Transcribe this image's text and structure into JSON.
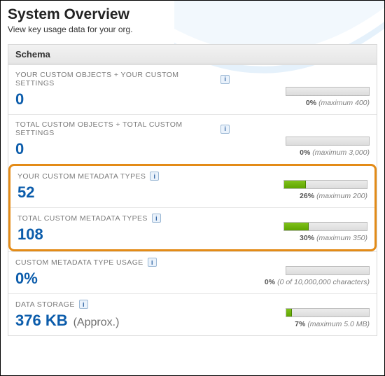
{
  "header": {
    "title": "System Overview",
    "subtitle": "View key usage data for your org."
  },
  "panel": {
    "title": "Schema"
  },
  "rows": [
    {
      "label": "YOUR CUSTOM OBJECTS + YOUR CUSTOM SETTINGS",
      "value": "0",
      "pct_label": "0%",
      "caption": "(maximum 400)",
      "fill_pct": 0
    },
    {
      "label": "TOTAL CUSTOM OBJECTS + TOTAL CUSTOM SETTINGS",
      "value": "0",
      "pct_label": "0%",
      "caption": "(maximum 3,000)",
      "fill_pct": 0
    },
    {
      "label": "YOUR CUSTOM METADATA TYPES",
      "value": "52",
      "pct_label": "26%",
      "caption": "(maximum 200)",
      "fill_pct": 26
    },
    {
      "label": "TOTAL CUSTOM METADATA TYPES",
      "value": "108",
      "pct_label": "30%",
      "caption": "(maximum 350)",
      "fill_pct": 30
    },
    {
      "label": "CUSTOM METADATA TYPE USAGE",
      "value": "0%",
      "pct_label": "0%",
      "caption": "(0 of 10,000,000 characters)",
      "fill_pct": 0
    },
    {
      "label": "DATA STORAGE",
      "value": "376 KB",
      "suffix": "(Approx.)",
      "pct_label": "7%",
      "caption": "(maximum 5.0 MB)",
      "fill_pct": 7
    }
  ]
}
